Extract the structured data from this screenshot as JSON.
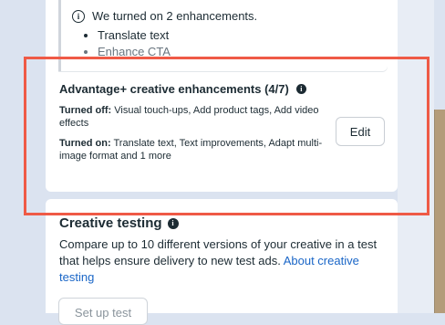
{
  "notice": {
    "message": "We turned on 2 enhancements.",
    "items": [
      "Translate text",
      "Enhance CTA"
    ]
  },
  "enhancements": {
    "title": "Advantage+ creative enhancements (4/7)",
    "turned_off_label": "Turned off:",
    "turned_off_value": "Visual touch-ups, Add product tags, Add video effects",
    "turned_on_label": "Turned on:",
    "turned_on_value": "Translate text, Text improvements, Adapt multi-image format and 1 more",
    "edit_label": "Edit"
  },
  "creative_testing": {
    "title": "Creative testing",
    "description": "Compare up to 10 different versions of your creative in a test that helps ensure delivery to new test ads.",
    "link_label": "About creative testing",
    "setup_label": "Set up test"
  },
  "icons": {
    "notice_icon": "info-outline-icon",
    "title_icon": "info-solid-icon"
  },
  "colors": {
    "highlight": "#ef5a46",
    "link": "#1a66c7"
  }
}
